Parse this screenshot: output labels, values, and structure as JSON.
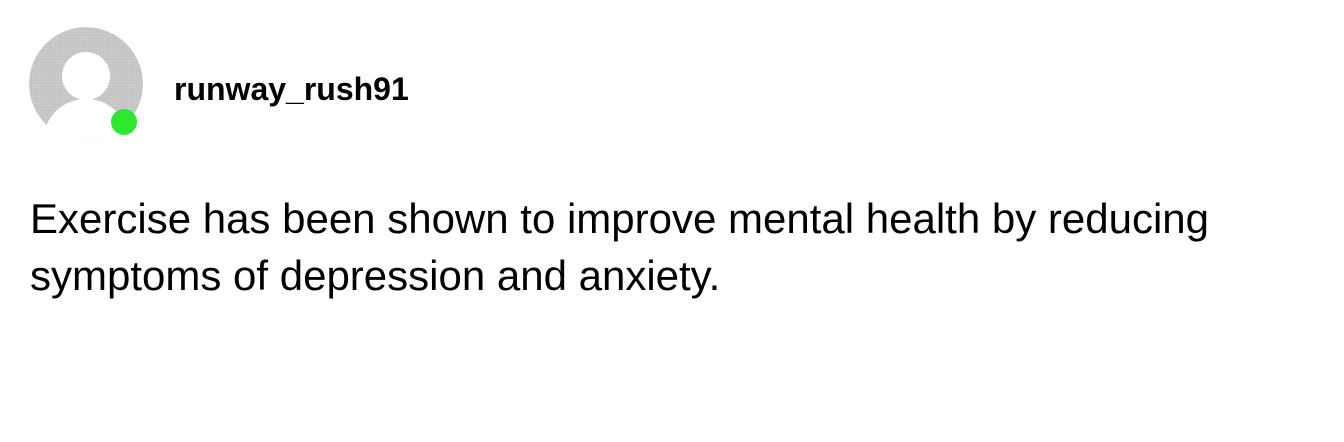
{
  "post": {
    "username": "runway_rush91",
    "text": "Exercise has been shown to improve mental health by reducing symptoms of depression and anxiety.",
    "avatar_icon": "default-user-icon",
    "status": "online"
  },
  "colors": {
    "avatar_bg": "#c8c8c8",
    "avatar_figure": "#ffffff",
    "status_online": "#2ee82e",
    "text": "#000000",
    "background": "#ffffff"
  }
}
